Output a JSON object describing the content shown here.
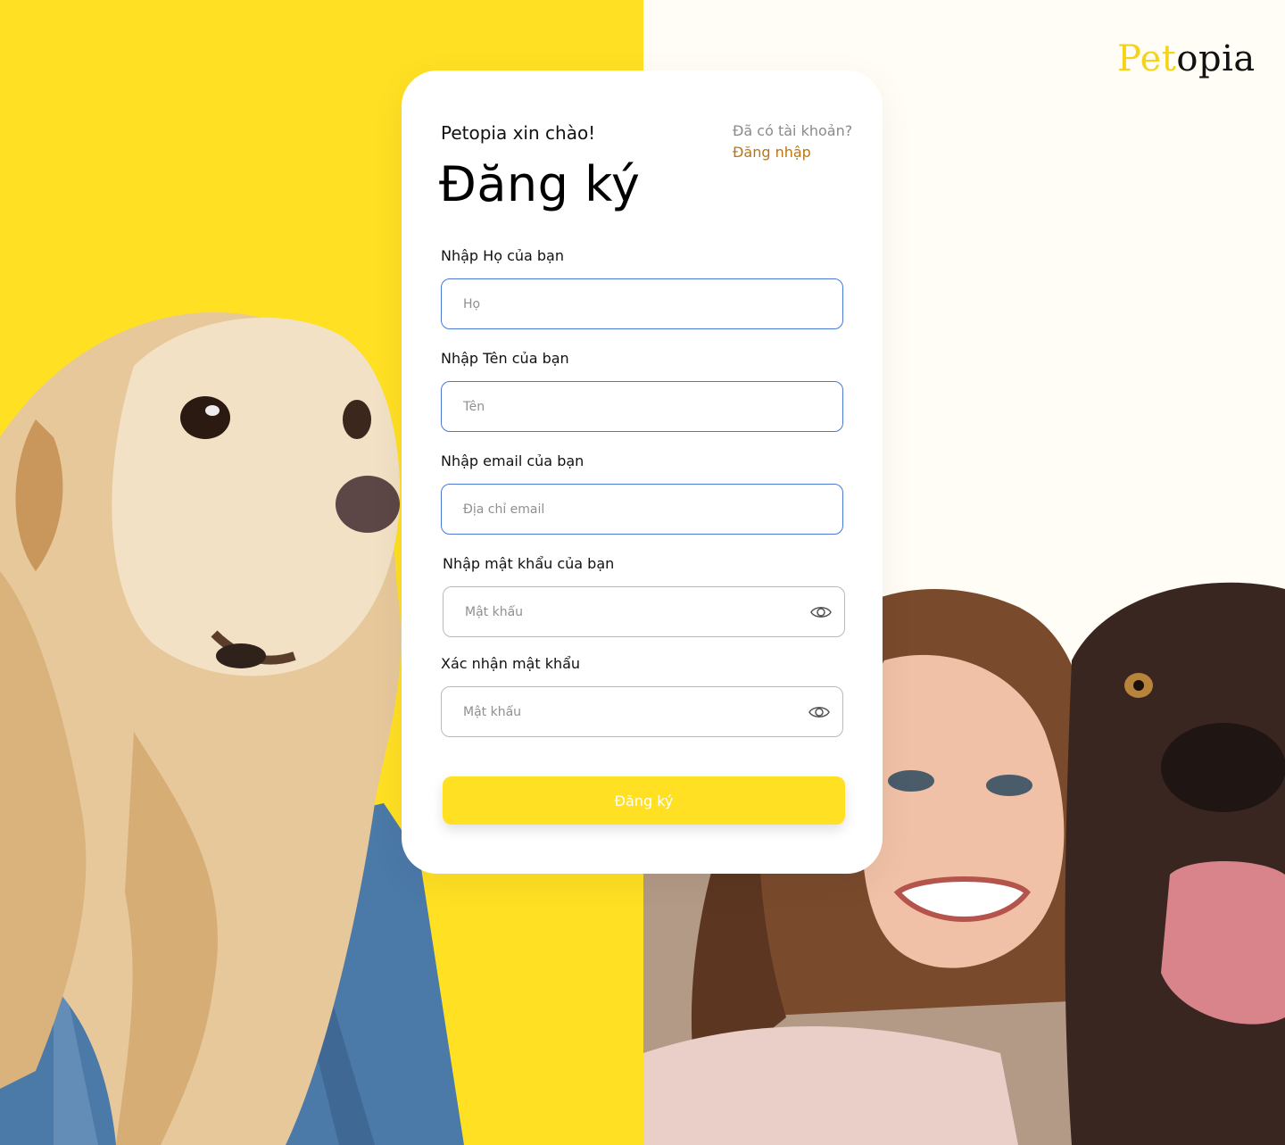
{
  "brand": {
    "logo_part1": "Pet",
    "logo_part2": "opia"
  },
  "header": {
    "greeting": "Petopia xin chào!",
    "title": "Đăng ký",
    "have_account": "Đã có tài khoản?",
    "login_link": "Đăng nhập"
  },
  "form": {
    "last_name": {
      "label": "Nhập Họ của bạn",
      "placeholder": "Họ",
      "value": ""
    },
    "first_name": {
      "label": "Nhập Tên của bạn",
      "placeholder": "Tên",
      "value": ""
    },
    "email": {
      "label": "Nhập email của bạn",
      "placeholder": "Địa chỉ email",
      "value": ""
    },
    "password": {
      "label": "Nhập mật khẩu của bạn",
      "placeholder": "Mật khẩu",
      "value": ""
    },
    "confirm_password": {
      "label": "Xác nhận mật khẩu",
      "placeholder": "Mật khẩu",
      "value": ""
    },
    "submit_label": "Đăng ký"
  },
  "colors": {
    "accent_yellow": "#FFE023",
    "link_brown": "#B87716",
    "input_focus_blue": "#4A78D4",
    "background_cream": "#FFFDF5"
  },
  "icons": {
    "password_toggle": "eye-icon",
    "confirm_password_toggle": "eye-icon"
  }
}
